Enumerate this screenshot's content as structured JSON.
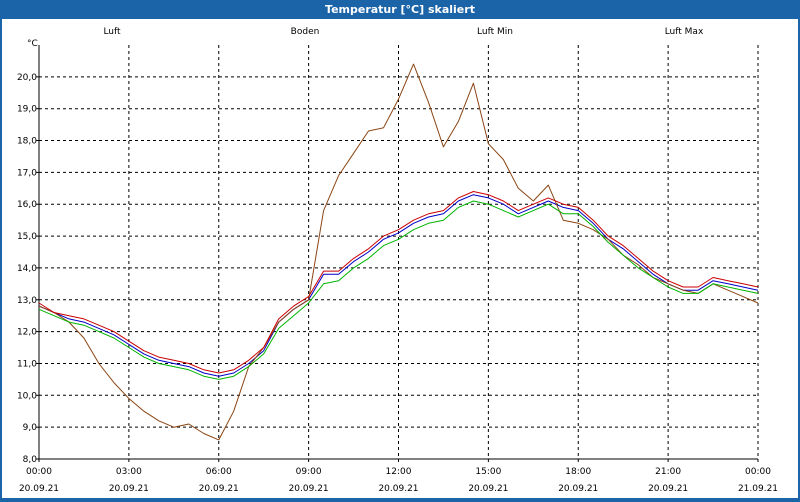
{
  "window": {
    "title": "Temperatur [°C] skaliert"
  },
  "chart_data": {
    "type": "line",
    "title": "Temperatur [°C] skaliert",
    "ylabel": "°C",
    "xlabel": "",
    "ylim": [
      8.0,
      21.0
    ],
    "yticks": [
      8.0,
      9.0,
      10.0,
      11.0,
      12.0,
      13.0,
      14.0,
      15.0,
      16.0,
      17.0,
      18.0,
      19.0,
      20.0
    ],
    "ytick_labels": [
      "8,0",
      "9,0",
      "10,0",
      "11,0",
      "12,0",
      "13,0",
      "14,0",
      "15,0",
      "16,0",
      "17,0",
      "18,0",
      "19,0",
      "20,0"
    ],
    "xlim": [
      0,
      24
    ],
    "xticks": [
      0,
      3,
      6,
      9,
      12,
      15,
      18,
      21,
      24
    ],
    "xtick_times": [
      "00:00",
      "03:00",
      "06:00",
      "09:00",
      "12:00",
      "15:00",
      "18:00",
      "21:00",
      "00:00"
    ],
    "xtick_dates": [
      "20.09.21",
      "20.09.21",
      "20.09.21",
      "20.09.21",
      "20.09.21",
      "20.09.21",
      "20.09.21",
      "20.09.21",
      "21.09.21"
    ],
    "grid": true,
    "legend_position": "top",
    "series": [
      {
        "name": "Luft",
        "color": "#0000c8",
        "x": [
          0,
          0.5,
          1,
          1.5,
          2,
          2.5,
          3,
          3.5,
          4,
          4.5,
          5,
          5.5,
          6,
          6.5,
          7,
          7.5,
          8,
          8.5,
          9,
          9.5,
          10,
          10.5,
          11,
          11.5,
          12,
          12.5,
          13,
          13.5,
          14,
          14.5,
          15,
          15.5,
          16,
          16.5,
          17,
          17.5,
          18,
          18.5,
          19,
          19.5,
          20,
          20.5,
          21,
          21.5,
          22,
          22.5,
          23,
          23.5,
          24
        ],
        "y": [
          12.8,
          12.6,
          12.4,
          12.3,
          12.1,
          11.9,
          11.6,
          11.3,
          11.1,
          11.0,
          10.9,
          10.7,
          10.6,
          10.7,
          11.0,
          11.4,
          12.3,
          12.7,
          13.0,
          13.8,
          13.8,
          14.2,
          14.5,
          14.9,
          15.1,
          15.4,
          15.6,
          15.7,
          16.1,
          16.3,
          16.2,
          16.0,
          15.7,
          15.9,
          16.1,
          15.9,
          15.8,
          15.4,
          14.9,
          14.6,
          14.2,
          13.8,
          13.5,
          13.3,
          13.3,
          13.6,
          13.5,
          13.4,
          13.3
        ]
      },
      {
        "name": "Boden",
        "color": "#8b4513",
        "x": [
          0,
          0.5,
          1,
          1.5,
          2,
          2.5,
          3,
          3.5,
          4,
          4.5,
          5,
          5.5,
          6,
          6.5,
          7,
          7.5,
          8,
          8.5,
          9,
          9.5,
          10,
          10.5,
          11,
          11.5,
          12,
          12.5,
          13,
          13.5,
          14,
          14.5,
          15,
          15.5,
          16,
          16.5,
          17,
          17.5,
          18,
          18.5,
          19,
          19.5,
          20,
          20.5,
          21,
          21.5,
          22,
          22.5,
          23,
          23.5,
          24
        ],
        "y": [
          12.8,
          12.6,
          12.3,
          11.8,
          11.0,
          10.4,
          9.9,
          9.5,
          9.2,
          9.0,
          9.1,
          8.8,
          8.6,
          9.5,
          10.9,
          11.5,
          12.3,
          12.7,
          13.0,
          15.8,
          16.9,
          17.6,
          18.3,
          18.4,
          19.3,
          20.4,
          19.2,
          17.8,
          18.6,
          19.8,
          17.9,
          17.4,
          16.5,
          16.1,
          16.6,
          15.5,
          15.4,
          15.2,
          14.9,
          14.4,
          14.1,
          13.7,
          13.5,
          13.3,
          13.2,
          13.5,
          13.3,
          13.1,
          12.9
        ]
      },
      {
        "name": "Luft Min",
        "color": "#00b400",
        "x": [
          0,
          0.5,
          1,
          1.5,
          2,
          2.5,
          3,
          3.5,
          4,
          4.5,
          5,
          5.5,
          6,
          6.5,
          7,
          7.5,
          8,
          8.5,
          9,
          9.5,
          10,
          10.5,
          11,
          11.5,
          12,
          12.5,
          13,
          13.5,
          14,
          14.5,
          15,
          15.5,
          16,
          16.5,
          17,
          17.5,
          18,
          18.5,
          19,
          19.5,
          20,
          20.5,
          21,
          21.5,
          22,
          22.5,
          23,
          23.5,
          24
        ],
        "y": [
          12.7,
          12.5,
          12.3,
          12.2,
          12.0,
          11.8,
          11.5,
          11.2,
          11.0,
          10.9,
          10.8,
          10.6,
          10.5,
          10.6,
          10.9,
          11.3,
          12.1,
          12.5,
          12.9,
          13.5,
          13.6,
          14.0,
          14.3,
          14.7,
          14.9,
          15.2,
          15.4,
          15.5,
          15.9,
          16.1,
          16.0,
          15.8,
          15.6,
          15.8,
          16.0,
          15.7,
          15.7,
          15.3,
          14.8,
          14.4,
          14.0,
          13.7,
          13.4,
          13.2,
          13.2,
          13.5,
          13.4,
          13.3,
          13.2
        ]
      },
      {
        "name": "Luft Max",
        "color": "#cc0000",
        "x": [
          0,
          0.5,
          1,
          1.5,
          2,
          2.5,
          3,
          3.5,
          4,
          4.5,
          5,
          5.5,
          6,
          6.5,
          7,
          7.5,
          8,
          8.5,
          9,
          9.5,
          10,
          10.5,
          11,
          11.5,
          12,
          12.5,
          13,
          13.5,
          14,
          14.5,
          15,
          15.5,
          16,
          16.5,
          17,
          17.5,
          18,
          18.5,
          19,
          19.5,
          20,
          20.5,
          21,
          21.5,
          22,
          22.5,
          23,
          23.5,
          24
        ],
        "y": [
          12.9,
          12.6,
          12.5,
          12.4,
          12.2,
          12.0,
          11.7,
          11.4,
          11.2,
          11.1,
          11.0,
          10.8,
          10.7,
          10.8,
          11.1,
          11.5,
          12.4,
          12.8,
          13.1,
          13.9,
          13.9,
          14.3,
          14.6,
          15.0,
          15.2,
          15.5,
          15.7,
          15.8,
          16.2,
          16.4,
          16.3,
          16.1,
          15.8,
          16.0,
          16.2,
          16.0,
          15.9,
          15.5,
          15.0,
          14.7,
          14.3,
          13.9,
          13.6,
          13.4,
          13.4,
          13.7,
          13.6,
          13.5,
          13.4
        ]
      }
    ]
  }
}
